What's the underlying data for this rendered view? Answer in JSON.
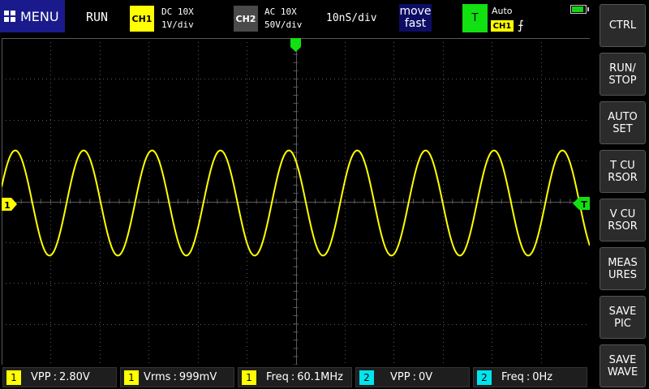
{
  "top_bar": {
    "menu_label": "MENU",
    "run_status": "RUN",
    "ch1": {
      "tag": "CH1",
      "coupling": "DC  10X",
      "scale": "1V/div"
    },
    "ch2": {
      "tag": "CH2",
      "coupling": "AC  10X",
      "scale": "50V/div"
    },
    "timebase": "10nS/div",
    "move_line1": "move",
    "move_line2": "fast",
    "trigger": {
      "tag": "T",
      "mode": "Auto",
      "source": "CH1",
      "edge_glyph": "⨍"
    }
  },
  "side_buttons": [
    "CTRL",
    "RUN/\nSTOP",
    "AUTO\nSET",
    "T CU\nRSOR",
    "V CU\nRSOR",
    "MEAS\nURES",
    "SAVE\nPIC",
    "SAVE\nWAVE"
  ],
  "markers": {
    "ch1_marker": "1",
    "trigger_marker": "T"
  },
  "measurements": [
    {
      "tag": "1",
      "name": "VPP",
      "value": "2.80V"
    },
    {
      "tag": "1",
      "name": "Vrms",
      "value": "999mV"
    },
    {
      "tag": "1",
      "name": "Freq",
      "value": "60.1MHz"
    },
    {
      "tag": "2",
      "name": "VPP",
      "value": "0V"
    },
    {
      "tag": "2",
      "name": "Freq",
      "value": "0Hz"
    }
  ],
  "colors": {
    "ch1": "#ffff00",
    "ch2": "#00e5ee",
    "trigger": "#11e011",
    "grid": "#5a5a5a"
  },
  "waveform": {
    "channel": "CH1",
    "type": "sine",
    "cycles_on_screen": 8.6,
    "vpp_div": 2.8
  }
}
